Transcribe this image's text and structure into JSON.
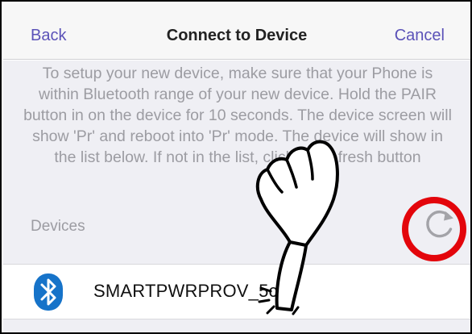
{
  "navbar": {
    "back_label": "Back",
    "title": "Connect to Device",
    "cancel_label": "Cancel"
  },
  "instructions": {
    "text": "To setup your new device, make sure that your Phone is within Bluetooth range of your new device. Hold the PAIR button in on the device for 10 seconds. The device screen will show 'Pr' and reboot into 'Pr' mode. The device will show in the list below. If not in the list, click the refresh button"
  },
  "devices_section": {
    "header": "Devices",
    "refresh_icon": "refresh-icon",
    "items": [
      {
        "name": "SMARTPWRPROV_5cd3",
        "icon": "bluetooth-icon"
      }
    ]
  },
  "annotations": {
    "highlight_color": "#e3050b",
    "pointer_icon": "pointing-hand-icon"
  },
  "colors": {
    "accent": "#5b52b8",
    "bluetooth": "#1673c9",
    "secondary_text": "#9c9ca2",
    "background": "#efeff4"
  }
}
